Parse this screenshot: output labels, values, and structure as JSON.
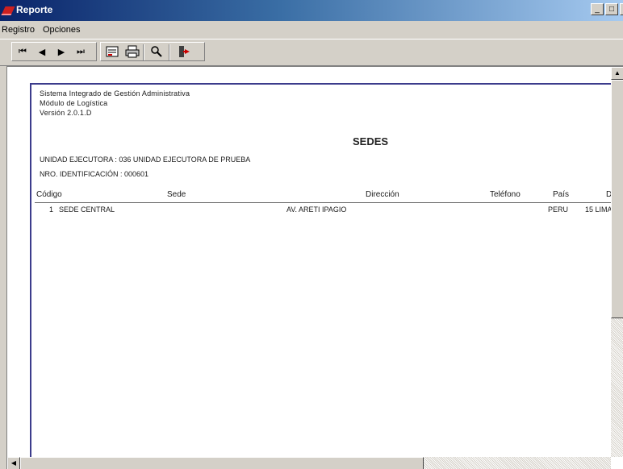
{
  "window": {
    "title": "Reporte",
    "buttons": [
      "_",
      "□",
      "×"
    ]
  },
  "menu": {
    "items": [
      "Registro",
      "Opciones"
    ]
  },
  "toolbar": {
    "nav": {
      "first": "⏮",
      "prev": "◀",
      "next": "▶",
      "last": "⏭"
    },
    "icons": [
      "export-icon",
      "print-icon",
      "search-icon",
      "exit-icon"
    ]
  },
  "report": {
    "header": [
      "Sistema Integrado de Gestión Administrativa",
      "Módulo de Logística",
      "Versión 2.0.1.D"
    ],
    "title": "SEDES",
    "unidad": "UNIDAD EJECUTORA : 036 UNIDAD EJECUTORA DE PRUEBA",
    "nro": "NRO. IDENTIFICACIÓN : 000601",
    "columns": [
      "Código",
      "Sede",
      "Dirección",
      "Teléfono",
      "País",
      "Dep"
    ],
    "rows": [
      {
        "codigo": "1",
        "sede": "SEDE CENTRAL",
        "direccion": "AV. ARETI IPAGIO",
        "telefono": "",
        "pais": "PERU",
        "dep": "15 LIMA"
      }
    ]
  }
}
